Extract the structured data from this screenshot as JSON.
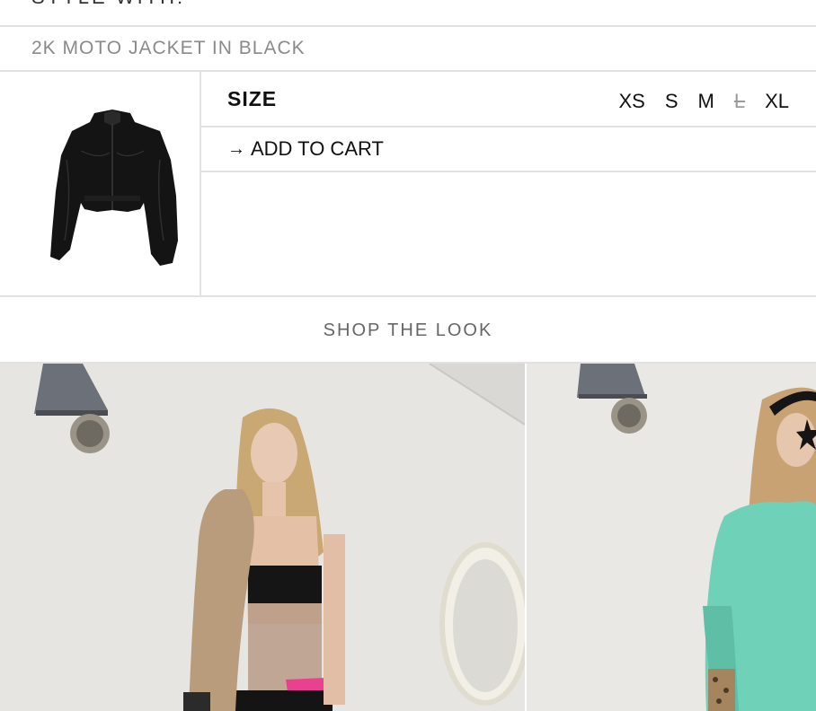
{
  "section_header": {
    "partial_text": "STYLE WITH:"
  },
  "product": {
    "name": "2K MOTO JACKET IN BLACK",
    "image_icon": "jacket-thumbnail",
    "size_label": "SIZE",
    "sizes": [
      {
        "label": "XS",
        "available": true
      },
      {
        "label": "S",
        "available": true
      },
      {
        "label": "M",
        "available": true
      },
      {
        "label": "L",
        "available": false
      },
      {
        "label": "XL",
        "available": true
      }
    ],
    "add_to_cart_arrow": "→",
    "add_to_cart_label": "ADD TO CART"
  },
  "shop_the_look": {
    "title": "SHOP THE LOOK"
  },
  "colors": {
    "border": "#e2e2e2",
    "text": "#111111",
    "muted": "#8a8a8a"
  }
}
